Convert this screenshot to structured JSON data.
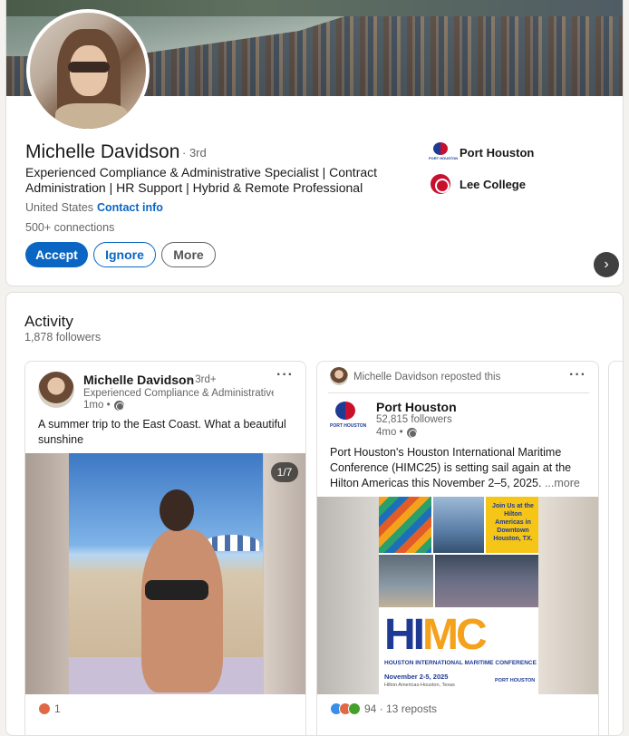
{
  "profile": {
    "name": "Michelle Davidson",
    "degree": "· 3rd",
    "headline": "Experienced Compliance & Administrative Specialist | Contract Administration | HR Support | Hybrid & Remote Professional",
    "location": "United States ·",
    "contact_info": "Contact info",
    "connections": "500+ connections",
    "buttons": {
      "accept": "Accept",
      "ignore": "Ignore",
      "more": "More"
    },
    "orgs": [
      {
        "name": "Port Houston",
        "logo_text": "PORT HOUSTON"
      },
      {
        "name": "Lee College"
      }
    ]
  },
  "activity": {
    "title": "Activity",
    "followers": "1,878 followers",
    "posts": [
      {
        "author": "Michelle Davidson",
        "degree": "• 3rd+",
        "subtitle": "Experienced Compliance & Administrative...",
        "time": "1mo •",
        "text": "A summer trip to the East Coast. What a beautiful sunshine",
        "image_counter": "1/7",
        "reactions": "1"
      },
      {
        "reposted_by": "Michelle Davidson reposted this",
        "author": "Port Houston",
        "subtitle": "52,815 followers",
        "time": "4mo •",
        "text": "Port Houston's Houston International Maritime Conference (HIMC25) is setting sail again at the Hilton Americas this November 2–5, 2025.",
        "more": "...more",
        "reactions": "94 · 13 reposts",
        "poster": {
          "headline_a": "HI",
          "headline_b": "MC",
          "subtitle": "HOUSTON INTERNATIONAL MARITIME CONFERENCE",
          "dates": "November 2-5, 2025",
          "venue": "Hilton Americas-Houston, Texas",
          "logo": "PORT HOUSTON",
          "callout": "Join Us at the Hilton Americas in Downtown Houston, TX."
        }
      }
    ],
    "next_arrow": "›",
    "kebab": "···"
  },
  "colors": {
    "accent": "#0a66c2",
    "port_houston_blue": "#1f3a93",
    "port_houston_red": "#c8102e"
  }
}
